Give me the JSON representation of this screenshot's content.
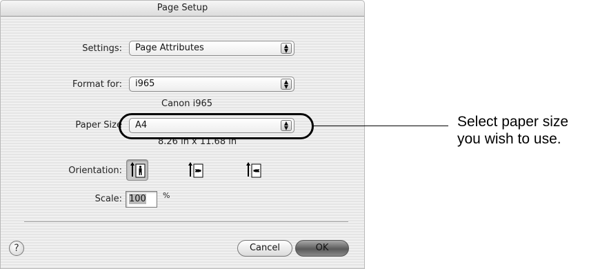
{
  "dialog": {
    "title": "Page Setup",
    "settings": {
      "label": "Settings:",
      "value": "Page Attributes"
    },
    "format_for": {
      "label": "Format for:",
      "value": "i965",
      "printer_name": "Canon i965"
    },
    "paper_size": {
      "label": "Paper Size",
      "value": "A4",
      "dimensions": "8.26 in x 11.68 in"
    },
    "orientation": {
      "label": "Orientation:",
      "options": [
        {
          "name": "portrait",
          "selected": true
        },
        {
          "name": "landscape",
          "selected": false
        },
        {
          "name": "reverse-landscape",
          "selected": false
        }
      ]
    },
    "scale": {
      "label": "Scale:",
      "value": "100",
      "unit": "%"
    },
    "help_glyph": "?",
    "buttons": {
      "cancel": "Cancel",
      "ok": "OK"
    },
    "popup_arrows": "▲▼"
  },
  "callout": {
    "line1": "Select paper size",
    "line2": "you wish to use."
  }
}
